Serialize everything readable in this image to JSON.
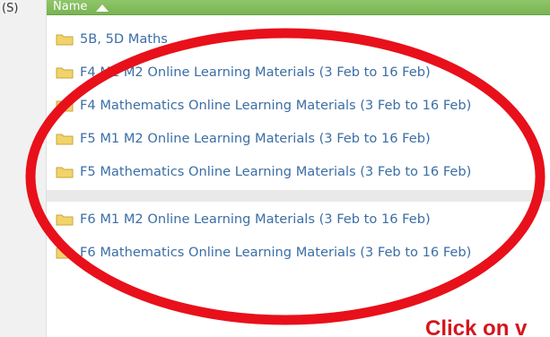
{
  "breadcrumb": "(S)",
  "header": {
    "column_name": "Name"
  },
  "folders": [
    {
      "label": "5B, 5D Maths"
    },
    {
      "label": "F4 M1 M2 Online Learning Materials (3 Feb to 16 Feb)"
    },
    {
      "label": "F4 Mathematics Online Learning Materials (3 Feb to 16 Feb)"
    },
    {
      "label": "F5 M1 M2 Online Learning Materials (3 Feb to 16 Feb)"
    },
    {
      "label": "F5 Mathematics Online Learning Materials (3 Feb to 16 Feb)"
    },
    {
      "label": "F6 M1 M2 Online Learning Materials (3 Feb to 16 Feb)"
    },
    {
      "label": "F6 Mathematics Online Learning Materials (3 Feb to 16 Feb)"
    }
  ],
  "callout": "Click on v",
  "colors": {
    "header_green": "#79b452",
    "link_blue": "#3b6ea5",
    "annotation_red": "#d4161d",
    "folder_yellow": "#f2d36b"
  },
  "icons": {
    "folder": "folder-icon",
    "sort": "sort-ascending-icon"
  }
}
